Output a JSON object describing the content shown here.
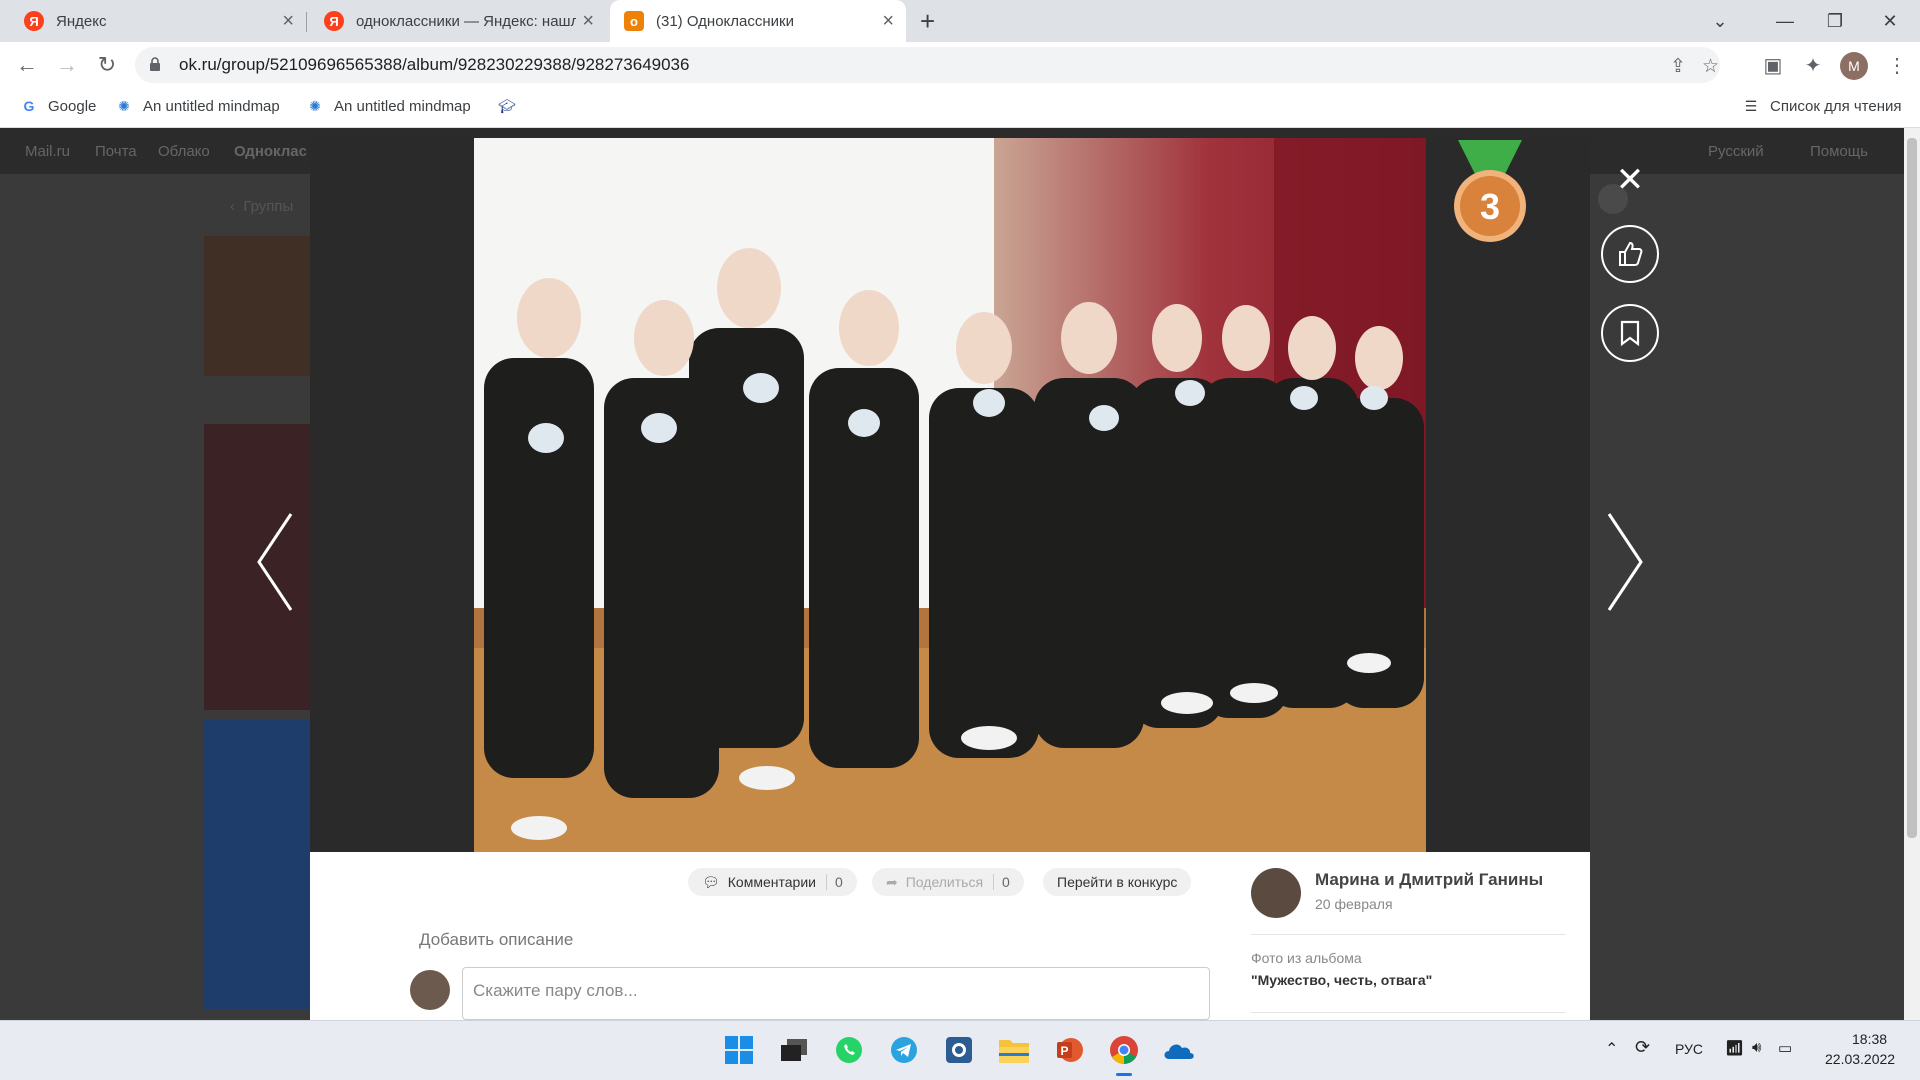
{
  "tabs": [
    {
      "title": "Яндекс",
      "favicon": "yandex-icon"
    },
    {
      "title": "одноклассники — Яндекс: нашл",
      "favicon": "yandex-icon"
    },
    {
      "title": "(31) Одноклассники",
      "favicon": "ok-icon"
    }
  ],
  "address_bar": {
    "url": "ok.ru/group/52109696565388/album/928230229388/928273649036"
  },
  "bookmarks": [
    {
      "label": "Google",
      "icon": "google-icon"
    },
    {
      "label": "An untitled mindmap",
      "icon": "mindmap-icon"
    },
    {
      "label": "An untitled mindmap",
      "icon": "mindmap-icon"
    },
    {
      "label": "",
      "icon": "graduation-cap-icon"
    }
  ],
  "reading_list": "Список для чтения",
  "profile_initial": "M",
  "ok_background": {
    "nav": [
      "Mail.ru",
      "Почта",
      "Облако",
      "Одноклас"
    ],
    "language": "Русский",
    "help": "Помощь",
    "groups_back": "Группы"
  },
  "viewer": {
    "medal_rank": "3",
    "actions": {
      "comments_label": "Комментарии",
      "comments_count": "0",
      "share_label": "Поделиться",
      "share_count": "0",
      "contest_label": "Перейти в конкурс"
    },
    "add_description": "Добавить описание",
    "comment_placeholder": "Скажите пару слов...",
    "author": {
      "name": "Марина и Дмитрий Ганины",
      "date": "20 февраля"
    },
    "album_label": "Фото из альбома",
    "album_name": "\"Мужество, честь, отвага\""
  },
  "taskbar": {
    "apps": [
      "windows-start-icon",
      "task-view-icon",
      "whatsapp-icon",
      "telegram-icon",
      "vk-messenger-icon",
      "file-explorer-icon",
      "powerpoint-icon",
      "chrome-icon",
      "onedrive-icon"
    ],
    "lang": "РУС",
    "time": "18:38",
    "date": "22.03.2022"
  },
  "colors": {
    "ok_orange": "#ee8208",
    "yandex_red": "#fc3f1d",
    "medal_bronze": "#d9823b",
    "medal_ribbon": "#3fae49"
  }
}
